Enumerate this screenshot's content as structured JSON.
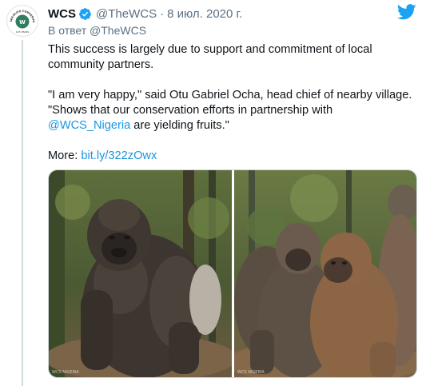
{
  "tweet": {
    "author": {
      "name": "WCS",
      "handle": "@TheWCS",
      "verified": true,
      "avatar_icon": "wcs-logo",
      "avatar_text": {
        "ring": "WILDLIFE CONSERVATION SOCIETY",
        "years": "125 YEARS"
      }
    },
    "separator": "·",
    "date": "8 июл. 2020 г.",
    "reply_to": {
      "prefix": "В ответ",
      "mention": "@TheWCS"
    },
    "body": {
      "p1": "This success is largely due to support and commitment of local community partners.",
      "p2_line1": "\"I am very happy,\" said Otu Gabriel Ocha, head chief of nearby village.",
      "p2_line2": "\"Shows that our conservation efforts in partnership with",
      "mention": "@WCS_Nigeria",
      "p2_tail": " are yielding fruits.\"",
      "more_prefix": "More: ",
      "more_link": "bit.ly/322zOwx"
    },
    "media": [
      {
        "name": "gorilla-photo-single",
        "icon": "gorilla-photo",
        "watermark": "WCS NIGERIA"
      },
      {
        "name": "gorilla-photo-group",
        "icon": "gorilla-photo",
        "watermark": "WCS NIGERIA"
      }
    ],
    "platform_icon": "twitter-bird-icon"
  },
  "colors": {
    "link": "#1b95e0",
    "verified": "#1da1f2",
    "brand": "#1da1f2",
    "secondary_text": "#5b7083",
    "thread_line": "#cfd9de",
    "logo_green": "#2f7f5f"
  }
}
